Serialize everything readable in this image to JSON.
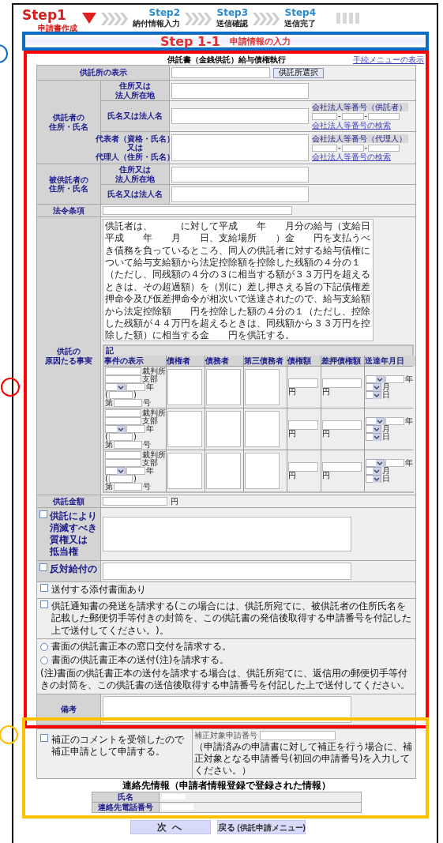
{
  "steps": [
    {
      "label": "Step1",
      "sub": "申請書作成",
      "selected": true
    },
    {
      "label": "Step2",
      "sub": "納付情報入力",
      "selected": false
    },
    {
      "label": "Step3",
      "sub": "送信確認",
      "selected": false
    },
    {
      "label": "Step4",
      "sub": "送信完了",
      "selected": false
    }
  ],
  "annotations": [
    {
      "color": "#0b6dc4"
    },
    {
      "color": "#ff0000"
    },
    {
      "color": "#ffc000"
    }
  ],
  "section_title": {
    "step": "Step 1-1",
    "title": "申請情報の入力"
  },
  "top_link": "手続メニューの表示",
  "form_title": "供託書（金銭供託）給与債権執行",
  "office": {
    "label": [
      "供託所の表示"
    ],
    "button": "供託所選択"
  },
  "depositor": {
    "label": [
      "供託者の",
      "住所・氏名"
    ],
    "rows": [
      [
        "住所又は",
        "法人所在地"
      ],
      [
        "氏名又は法人名"
      ],
      [
        "代表者（資格・氏名）",
        "又は",
        "代理人（住所・氏名）"
      ]
    ],
    "corp_numbers": [
      {
        "title": "会社法人等番号（供託者）",
        "separators": [
          "-",
          "-"
        ],
        "link": "会社法人等番号の検索"
      },
      {
        "title": "会社法人等番号（代理人）",
        "separators": [
          "-",
          "-"
        ],
        "link": "会社法人等番号の検索"
      }
    ]
  },
  "respondent": {
    "label": [
      "被供託者の",
      "住所・氏名"
    ],
    "rows": [
      [
        "住所又は",
        "法人所在地"
      ],
      [
        "氏名又は法人名"
      ]
    ]
  },
  "law": {
    "label": [
      "法令条項"
    ]
  },
  "cause": {
    "label": [
      "供託の",
      "原因たる事実"
    ],
    "text": "供託者は、　　　に対して平成　　年　　月分の給与（支給日平成　　年　　月　　日、支給場所　　）金　　円を支払うべき債務を負っているところ、同人の供託者に対する給与債権について給与支給額から法定控除額を控除した残額の４分の１（ただし、同残額の４分の３に相当する額が３３万円を超えるときは、その超過額）を（別に）差し押さえる旨の下記債権差押命令及び仮差押命令が相次いで送達されたので、給与支給額から法定控除額　　円を控除した額の４分の１（ただし、控除した残額が４４万円を超えるときは、同残額から３３万円を控除した額）に相当する金　　円を供託する。",
    "table_title": "記",
    "columns": [
      "事件の表示",
      "債権者",
      "債務者",
      "第三債務者",
      "債権額",
      "差押債権額",
      "送達年月日"
    ],
    "rows": [
      {
        "court": "裁判所",
        "branch": "支部",
        "year": "年",
        "paren_open": "(",
        "paren_close": ")",
        "no_prefix": "第",
        "no_suffix": "号",
        "claim_unit": "円",
        "seized_unit": "円",
        "date_units": [
          "年",
          "月",
          "日"
        ]
      },
      {
        "court": "裁判所",
        "branch": "支部",
        "year": "年",
        "paren_open": "(",
        "paren_close": ")",
        "no_prefix": "第",
        "no_suffix": "号",
        "claim_unit": "円",
        "seized_unit": "円",
        "date_units": [
          "年",
          "月",
          "日"
        ]
      },
      {
        "court": "裁判所",
        "branch": "支部",
        "year": "年",
        "paren_open": "(",
        "paren_close": ")",
        "no_prefix": "第",
        "no_suffix": "号",
        "claim_unit": "円",
        "seized_unit": "円",
        "date_units": [
          "年",
          "月",
          "日"
        ]
      }
    ]
  },
  "amount": {
    "label": [
      "供託金額"
    ],
    "unit": "円"
  },
  "extinguish": {
    "label": [
      "供託により",
      "消滅すべき",
      "質権又は",
      "抵当権"
    ],
    "checked": false
  },
  "counter": {
    "label": [
      "反対給付の"
    ],
    "checked": false
  },
  "options": [
    {
      "kind": "checkbox",
      "text": "送付する添付書面あり",
      "checked": false
    },
    {
      "kind": "checkbox",
      "text": "供託通知書の発送を請求する(この場合には、供託所宛てに、被供託者の住所氏名を記載した郵便切手等付きの封筒を、この供託書の発信後取得する申請番号を付記した上で送付してください。)。",
      "checked": false
    }
  ],
  "delivery": {
    "choices": [
      {
        "text": "書面の供託書正本の窓口交付を請求する。",
        "selected": false
      },
      {
        "text": "書面の供託書正本の送付(注)を請求する。",
        "selected": false
      }
    ],
    "note": "(注)書面の供託書正本の送付を請求する場合は、供託所宛てに、返信用の郵便切手等付きの封筒を、この供託書の送信後取得する申請番号を付記した上で送付してください。"
  },
  "remarks": {
    "label": [
      "備考"
    ]
  },
  "correction": {
    "text": [
      "補正のコメントを受領したので",
      "補正申請として申請する。"
    ],
    "checked": false,
    "number_label": "補正対象申請番号",
    "note": "（申請済みの申請書に対して補正を行う場合に、補正対象となる申請番号(初回の申請番号)を入力してください。）"
  },
  "contact": {
    "title": "連絡先情報（申請者情報登録で登録された情報）",
    "rows": [
      "氏名",
      "連絡先電話番号"
    ]
  },
  "buttons": [
    {
      "kind": "next",
      "label": "次 へ"
    },
    {
      "kind": "back",
      "label": "戻る",
      "sub": "(供託申請メニュー)"
    }
  ]
}
